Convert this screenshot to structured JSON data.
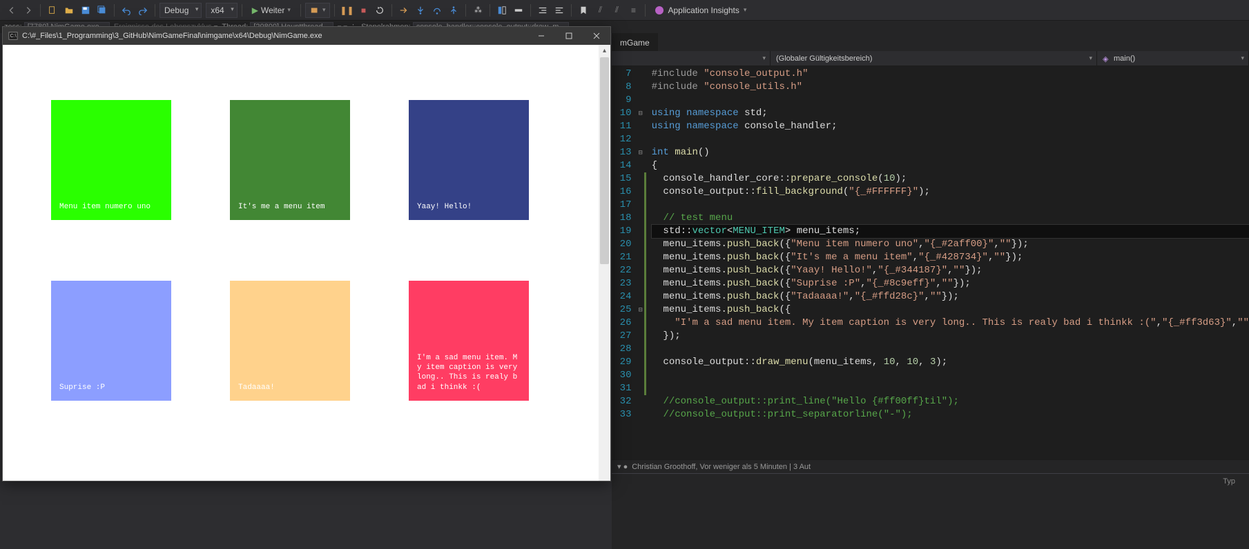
{
  "toolbar": {
    "config": "Debug",
    "platform": "x64",
    "continue_label": "Weiter",
    "insights_label": "Application Insights"
  },
  "debug_row": {
    "process_label": "zess:",
    "process": "[7780] NimGame.exe",
    "events": "Ereignisse des Lebenszyklus",
    "thread_label": "Thread:",
    "thread": "[20800] Hauptthread",
    "stack_label": "Stapelrahmen:",
    "stack": "console_handler::console_output::draw_m"
  },
  "app_window": {
    "title": "C:\\#_Files\\1_Programming\\3_GitHub\\NimGameFinal\\nimgame\\x64\\Debug\\NimGame.exe"
  },
  "menu_tiles": [
    {
      "text": "Menu item numero uno",
      "bg": "#2aff00",
      "fg": "#ffffff"
    },
    {
      "text": "It's me a menu item",
      "bg": "#428734",
      "fg": "#ffffff"
    },
    {
      "text": "Yaay! Hello!",
      "bg": "#344187",
      "fg": "#ffffff"
    },
    {
      "text": "Suprise :P",
      "bg": "#8c9eff",
      "fg": "#ffffff"
    },
    {
      "text": "Tadaaaa!",
      "bg": "#ffd28c",
      "fg": "#ffffff"
    },
    {
      "text": "I'm a sad menu item. My item caption is very long.. This is realy bad i thinkk :(",
      "bg": "#ff3d63",
      "fg": "#ffffff"
    }
  ],
  "editor": {
    "tab": "mGame",
    "scope": "(Globaler Gültigkeitsbereich)",
    "member": "main()",
    "blame": "Christian Groothoff, Vor weniger als 5 Minuten | 3 Aut",
    "output_tab": "Typ"
  },
  "code": [
    {
      "n": 7,
      "fold": "",
      "chg": "",
      "html": "<span class='tok-preproc'>#include</span> <span class='tok-str'>\"console_output.h\"</span>"
    },
    {
      "n": 8,
      "fold": "",
      "chg": "",
      "html": "<span class='tok-preproc'>#include</span> <span class='tok-str'>\"console_utils.h\"</span>"
    },
    {
      "n": 9,
      "fold": "",
      "chg": "",
      "html": ""
    },
    {
      "n": 10,
      "fold": "⊟",
      "chg": "",
      "html": "<span class='tok-kw'>using</span> <span class='tok-kw'>namespace</span> std;"
    },
    {
      "n": 11,
      "fold": "",
      "chg": "",
      "html": "<span class='tok-kw'>using</span> <span class='tok-kw'>namespace</span> console_handler;"
    },
    {
      "n": 12,
      "fold": "",
      "chg": "",
      "html": ""
    },
    {
      "n": 13,
      "fold": "⊟",
      "chg": "",
      "html": "<span class='tok-kw'>int</span> <span class='tok-fn'>main</span>()"
    },
    {
      "n": 14,
      "fold": "",
      "chg": "",
      "html": "{"
    },
    {
      "n": 15,
      "fold": "",
      "chg": "green",
      "html": "  console_handler_core::<span class='tok-fn'>prepare_console</span>(<span class='tok-num'>10</span>);"
    },
    {
      "n": 16,
      "fold": "",
      "chg": "green",
      "html": "  console_output::<span class='tok-fn'>fill_background</span>(<span class='tok-str'>\"{_#FFFFFF}\"</span>);"
    },
    {
      "n": 17,
      "fold": "",
      "chg": "green",
      "html": ""
    },
    {
      "n": 18,
      "fold": "",
      "chg": "green",
      "html": "  <span class='tok-comment'>// test menu</span>"
    },
    {
      "n": 19,
      "fold": "",
      "chg": "green",
      "html": "  std::<span class='tok-type'>vector</span>&lt;<span class='tok-type'>MENU_ITEM</span>&gt; menu_items;",
      "current": true
    },
    {
      "n": 20,
      "fold": "",
      "chg": "green",
      "html": "  menu_items.<span class='tok-fn'>push_back</span>({<span class='tok-str'>\"Menu item numero uno\"</span>,<span class='tok-str'>\"{_#2aff00}\"</span>,<span class='tok-str'>\"\"</span>});"
    },
    {
      "n": 21,
      "fold": "",
      "chg": "green",
      "html": "  menu_items.<span class='tok-fn'>push_back</span>({<span class='tok-str'>\"It's me a menu item\"</span>,<span class='tok-str'>\"{_#428734}\"</span>,<span class='tok-str'>\"\"</span>});"
    },
    {
      "n": 22,
      "fold": "",
      "chg": "green",
      "html": "  menu_items.<span class='tok-fn'>push_back</span>({<span class='tok-str'>\"Yaay! Hello!\"</span>,<span class='tok-str'>\"{_#344187}\"</span>,<span class='tok-str'>\"\"</span>});"
    },
    {
      "n": 23,
      "fold": "",
      "chg": "green",
      "html": "  menu_items.<span class='tok-fn'>push_back</span>({<span class='tok-str'>\"Suprise :P\"</span>,<span class='tok-str'>\"{_#8c9eff}\"</span>,<span class='tok-str'>\"\"</span>});"
    },
    {
      "n": 24,
      "fold": "",
      "chg": "green",
      "html": "  menu_items.<span class='tok-fn'>push_back</span>({<span class='tok-str'>\"Tadaaaa!\"</span>,<span class='tok-str'>\"{_#ffd28c}\"</span>,<span class='tok-str'>\"\"</span>});"
    },
    {
      "n": 25,
      "fold": "⊟",
      "chg": "green",
      "html": "  menu_items.<span class='tok-fn'>push_back</span>({"
    },
    {
      "n": 26,
      "fold": "",
      "chg": "green",
      "html": "    <span class='tok-str'>\"I'm a sad menu item. My item caption is very long.. This is realy bad i thinkk :(\"</span>,<span class='tok-str'>\"{_#ff3d63}\"</span>,<span class='tok-str'>\"\"</span>"
    },
    {
      "n": 27,
      "fold": "",
      "chg": "green",
      "html": "  });"
    },
    {
      "n": 28,
      "fold": "",
      "chg": "green",
      "html": ""
    },
    {
      "n": 29,
      "fold": "",
      "chg": "green",
      "html": "  console_output::<span class='tok-fn'>draw_menu</span>(menu_items, <span class='tok-num'>10</span>, <span class='tok-num'>10</span>, <span class='tok-num'>3</span>);"
    },
    {
      "n": 30,
      "fold": "",
      "chg": "green",
      "html": ""
    },
    {
      "n": 31,
      "fold": "",
      "chg": "green",
      "html": ""
    },
    {
      "n": 32,
      "fold": "",
      "chg": "",
      "html": "  <span class='tok-comment'>//console_output::print_line(\"Hello {#ff00ff}til\");</span>"
    },
    {
      "n": 33,
      "fold": "",
      "chg": "",
      "html": "  <span class='tok-comment'>//console_output::print_separatorline(\"-\");</span>"
    }
  ]
}
